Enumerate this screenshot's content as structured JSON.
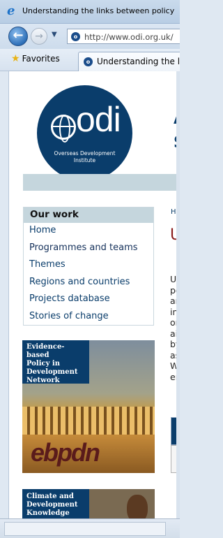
{
  "window": {
    "title": "Understanding the links between policy"
  },
  "navigation": {
    "address_url": "http://www.odi.org.uk/"
  },
  "favorites_bar": {
    "favorites_label": "Favorites",
    "tab_label": "Understanding the lin"
  },
  "logo": {
    "brand": "odi",
    "subtitle_line1": "Overseas Development",
    "subtitle_line2": "Institute"
  },
  "page_fragments": {
    "heading_initial_a": "A",
    "heading_initial_s": "S",
    "navbar_letter": "H",
    "breadcrumb": "Ho",
    "page_title_letter": "U",
    "body_lines": "Ur\npo\nar\nin\nor\nai\nby\nas\nW\nen"
  },
  "sidebar": {
    "heading": "Our work",
    "items": [
      {
        "label": "Home"
      },
      {
        "label": "Programmes and teams"
      },
      {
        "label": "Themes"
      },
      {
        "label": "Regions and countries"
      },
      {
        "label": "Projects database"
      },
      {
        "label": "Stories of change"
      }
    ]
  },
  "promos": [
    {
      "line1": "Evidence-based",
      "line2": "Policy in",
      "line3": "Development",
      "line4": "Network",
      "logo_text": "ebpdn"
    },
    {
      "line1": "Climate and",
      "line2": "Development",
      "line3": "Knowledge"
    }
  ]
}
